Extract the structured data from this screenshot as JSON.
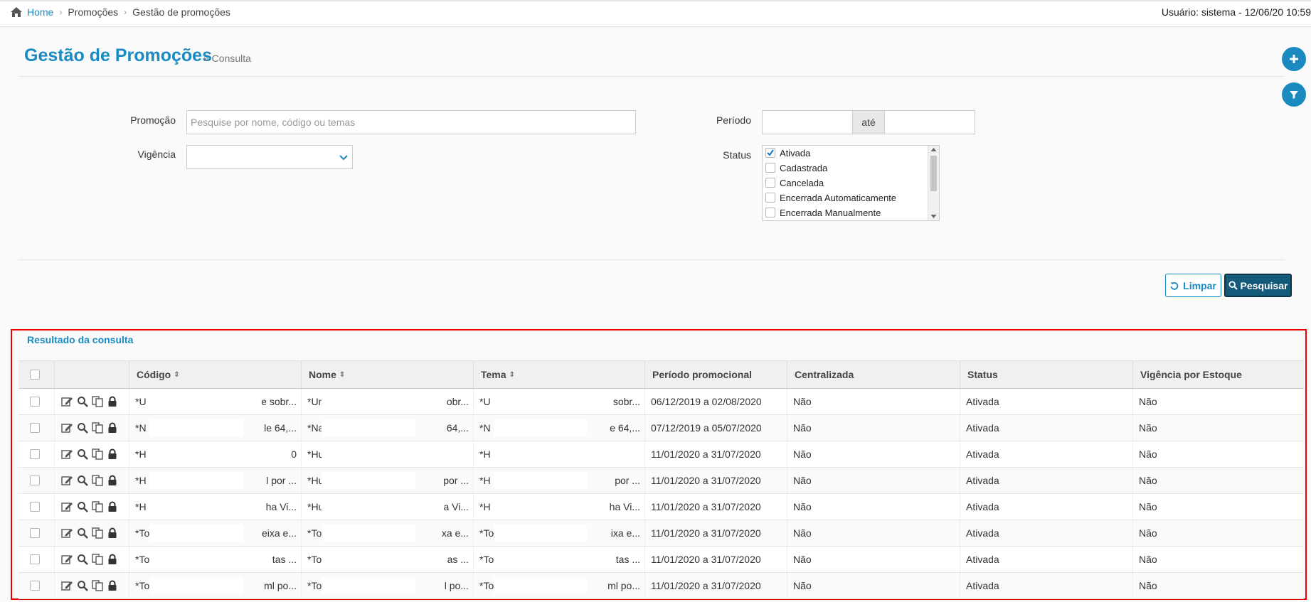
{
  "breadcrumb": {
    "home": "Home",
    "level1": "Promoções",
    "level2": "Gestão de promoções"
  },
  "user_info": "Usuário: sistema - 12/06/20 10:59",
  "page": {
    "title": "Gestão de Promoções",
    "subtitle": "» Consulta"
  },
  "form": {
    "promocao_label": "Promoção",
    "promocao_placeholder": "Pesquise por nome, código ou temas",
    "vigencia_label": "Vigência",
    "periodo_label": "Período",
    "ate_label": "até",
    "status_label": "Status",
    "status_options": [
      {
        "label": "Ativada",
        "checked": true
      },
      {
        "label": "Cadastrada",
        "checked": false
      },
      {
        "label": "Cancelada",
        "checked": false
      },
      {
        "label": "Encerrada Automaticamente",
        "checked": false
      },
      {
        "label": "Encerrada Manualmente",
        "checked": false
      }
    ]
  },
  "buttons": {
    "limpar": "Limpar",
    "pesquisar": "Pesquisar"
  },
  "results": {
    "title": "Resultado da consulta",
    "columns": [
      "Código",
      "Nome",
      "Tema",
      "Período promocional",
      "Centralizada",
      "Status",
      "Vigência por Estoque"
    ],
    "rows": [
      {
        "codigo_start": "*U",
        "codigo_end": "e sobr...",
        "nome_start": "*Un",
        "nome_end": "obr...",
        "tema_start": "*U",
        "tema_end": "sobr...",
        "periodo": "06/12/2019 a 02/08/2020",
        "centralizada": "Não",
        "status": "Ativada",
        "vigencia": "Não"
      },
      {
        "codigo_start": "*N",
        "codigo_end": "le 64,...",
        "nome_start": "*Na",
        "nome_end": "64,...",
        "tema_start": "*N",
        "tema_end": "e 64,...",
        "periodo": "07/12/2019 a 05/07/2020",
        "centralizada": "Não",
        "status": "Ativada",
        "vigencia": "Não"
      },
      {
        "codigo_start": "*H",
        "codigo_end": "0",
        "nome_start": "*Hu",
        "nome_end": "",
        "tema_start": "*H",
        "tema_end": "",
        "periodo": "11/01/2020 a 31/07/2020",
        "centralizada": "Não",
        "status": "Ativada",
        "vigencia": "Não"
      },
      {
        "codigo_start": "*H",
        "codigo_end": "l por ...",
        "nome_start": "*Hu",
        "nome_end": "por ...",
        "tema_start": "*H",
        "tema_end": "por ...",
        "periodo": "11/01/2020 a 31/07/2020",
        "centralizada": "Não",
        "status": "Ativada",
        "vigencia": "Não"
      },
      {
        "codigo_start": "*H",
        "codigo_end": "ha Vi...",
        "nome_start": "*Hu",
        "nome_end": "a Vi...",
        "tema_start": "*H",
        "tema_end": "ha Vi...",
        "periodo": "11/01/2020 a 31/07/2020",
        "centralizada": "Não",
        "status": "Ativada",
        "vigencia": "Não"
      },
      {
        "codigo_start": "*To",
        "codigo_end": "eixa e...",
        "nome_start": "*Toc",
        "nome_end": "xa e...",
        "tema_start": "*To",
        "tema_end": "ixa e...",
        "periodo": "11/01/2020 a 31/07/2020",
        "centralizada": "Não",
        "status": "Ativada",
        "vigencia": "Não"
      },
      {
        "codigo_start": "*To",
        "codigo_end": "tas ...",
        "nome_start": "*Toc",
        "nome_end": "as ...",
        "tema_start": "*To",
        "tema_end": "tas ...",
        "periodo": "11/01/2020 a 31/07/2020",
        "centralizada": "Não",
        "status": "Ativada",
        "vigencia": "Não"
      },
      {
        "codigo_start": "*To",
        "codigo_end": "ml po...",
        "nome_start": "*Toc",
        "nome_end": "l po...",
        "tema_start": "*To",
        "tema_end": "ml po...",
        "periodo": "11/01/2020 a 31/07/2020",
        "centralizada": "Não",
        "status": "Ativada",
        "vigencia": "Não"
      }
    ]
  },
  "colors": {
    "primary": "#1a8ac0",
    "primary_dark": "#145a7a",
    "highlight_border": "#e00000"
  },
  "icons": [
    "home-icon",
    "plus-icon",
    "filter-icon",
    "chevron-down-icon",
    "refresh-icon",
    "search-icon",
    "edit-icon",
    "view-icon",
    "copy-icon",
    "lock-icon",
    "sort-icon"
  ]
}
